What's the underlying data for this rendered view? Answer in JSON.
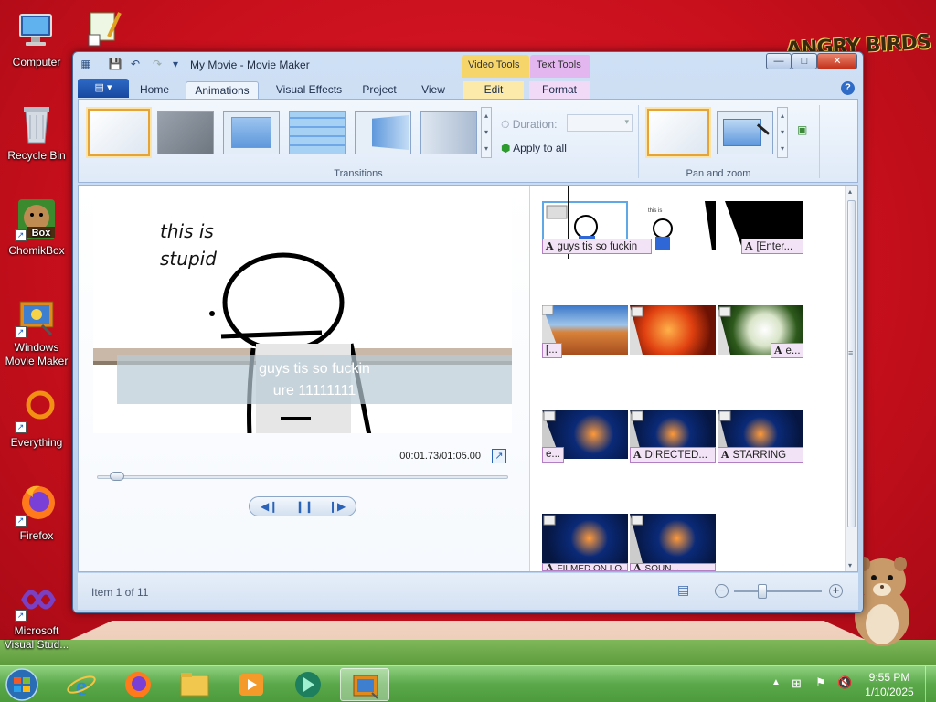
{
  "desktop": {
    "icons": [
      {
        "label": "Computer",
        "icon": "computer-icon"
      },
      {
        "label": "Recycle Bin",
        "icon": "recycle-bin-icon"
      },
      {
        "label": "ChomikBox",
        "icon": "chomikbox-icon",
        "badge": "Box"
      },
      {
        "label": "Windows Movie Maker",
        "icon": "movie-maker-icon"
      },
      {
        "label": "Everything",
        "icon": "everything-icon"
      },
      {
        "label": "Firefox",
        "icon": "firefox-icon"
      },
      {
        "label": "Microsoft Visual Stud...",
        "icon": "visual-studio-icon"
      }
    ],
    "wallpaper_logo": "ANGRY BIRDS"
  },
  "window": {
    "title": "My Movie - Movie Maker",
    "context_tabs": [
      {
        "label": "Video Tools",
        "color": "#f6d66a"
      },
      {
        "label": "Text Tools",
        "color": "#e3b6ef"
      }
    ],
    "tabs": [
      "Home",
      "Animations",
      "Visual Effects",
      "Project",
      "View",
      "Edit",
      "Format"
    ],
    "active_tab": "Animations"
  },
  "ribbon": {
    "transitions_label": "Transitions",
    "duration_label": "Duration:",
    "duration_value": "",
    "apply_all_label": "Apply to all",
    "pan_zoom_label": "Pan and zoom"
  },
  "preview": {
    "overlay_text_1": "this is",
    "overlay_text_2": "stupid",
    "caption_line_1": "guys tis so fuckin",
    "caption_line_2": "ure 11111111",
    "time": "00:01.73/01:05.00",
    "progress": 0.03
  },
  "storyboard": {
    "captions": {
      "r1a": "guys tis so fuckin",
      "r1b": "[Enter...",
      "r2a": "[...",
      "r2b": "e...",
      "r3a": "e...",
      "r3b": "DIRECTED...",
      "r3c": "STARRING",
      "r4a": "FILMED ON LO...",
      "r4b": "SOUN..."
    }
  },
  "status": {
    "item_text": "Item 1 of 11",
    "zoom": 0.3
  },
  "taskbar": {
    "time": "9:55 PM",
    "date": "1/10/2025"
  },
  "colors": {
    "accent": "#1e5bc2",
    "caption_bg": "#f3e3f6",
    "wallpaper": "#d6121f",
    "taskbar": "#5aa84a"
  }
}
